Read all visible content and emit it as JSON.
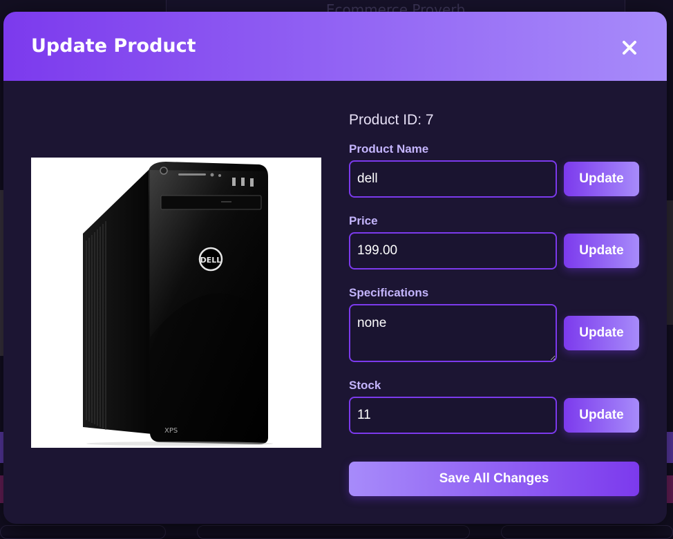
{
  "background": {
    "header_text": "Ecommerce Proverb"
  },
  "modal": {
    "title": "Update Product",
    "close_icon": "close-icon",
    "product_id_text": "Product ID: 7",
    "image_alt": "Dell XPS desktop tower",
    "fields": {
      "name": {
        "label": "Product Name",
        "value": "dell",
        "button": "Update"
      },
      "price": {
        "label": "Price",
        "value": "199.00",
        "button": "Update"
      },
      "specifications": {
        "label": "Specifications",
        "value": "none",
        "button": "Update"
      },
      "stock": {
        "label": "Stock",
        "value": "11",
        "button": "Update"
      }
    },
    "save_label": "Save All Changes"
  },
  "colors": {
    "accent": "#7c3aed",
    "accent_light": "#a78bfa",
    "modal_bg": "#1c1533",
    "label": "#c4b5fd"
  }
}
